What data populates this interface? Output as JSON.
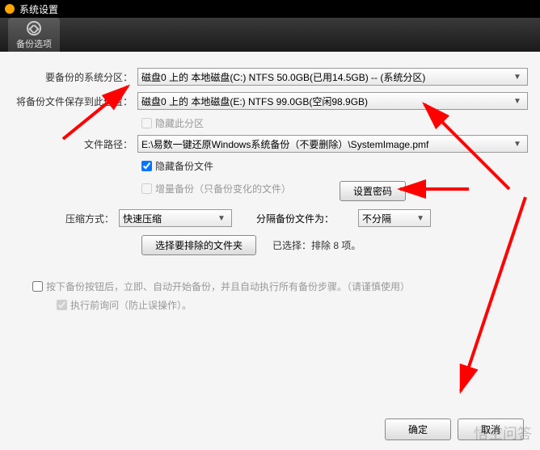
{
  "titlebar": {
    "text": "系统设置"
  },
  "tab": {
    "label": "备份选项"
  },
  "form": {
    "partition_label": "要备份的系统分区：",
    "partition_value": "磁盘0 上的 本地磁盘(C:) NTFS 50.0GB(已用14.5GB) -- (系统分区)",
    "save_label": "将备份文件保存到此位置：",
    "save_value": "磁盘0 上的 本地磁盘(E:) NTFS 99.0GB(空闲98.9GB)",
    "hide_partition": "隐藏此分区",
    "path_label": "文件路径：",
    "path_value": "E:\\易数一键还原Windows系统备份（不要删除）\\SystemImage.pmf",
    "hide_backup_file": "隐藏备份文件",
    "incremental": "增量备份（只备份变化的文件）",
    "set_password": "设置密码",
    "compress_label": "压缩方式：",
    "compress_value": "快速压缩",
    "split_label": "分隔备份文件为：",
    "split_value": "不分隔",
    "exclude_button": "选择要排除的文件夹",
    "selected_label": "已选择：排除 8 项。"
  },
  "auto": {
    "main": "按下备份按钮后，立即、自动开始备份，并且自动执行所有备份步骤。（请谨慎使用）",
    "sub": "执行前询问（防止误操作）。"
  },
  "buttons": {
    "ok": "确定",
    "cancel": "取消"
  }
}
